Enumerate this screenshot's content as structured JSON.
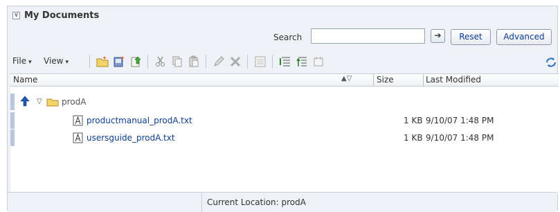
{
  "panel": {
    "collapse_glyph": "∨",
    "title": "My Documents"
  },
  "search": {
    "label": "Search",
    "value": "",
    "placeholder": "",
    "go_glyph": "➔",
    "reset_label": "Reset",
    "advanced_label": "Advanced"
  },
  "toolbar": {
    "file_label": "File",
    "view_label": "View",
    "caret": "▾",
    "icons": [
      "new-folder-icon",
      "new-document-icon",
      "upload-icon",
      "cut-icon",
      "copy-icon",
      "paste-icon",
      "edit-icon",
      "delete-icon",
      "batch-icon",
      "expand-all-icon",
      "collapse-all-icon",
      "properties-icon",
      "refresh-icon"
    ]
  },
  "table": {
    "columns": {
      "name": "Name",
      "sort": "▲▽",
      "size": "Size",
      "modified": "Last Modified"
    },
    "folder": {
      "up_glyph": "🡅",
      "toggle": "▽",
      "name": "prodA"
    },
    "files": [
      {
        "name": "productmanual_prodA.txt",
        "size": "1 KB",
        "modified": "9/10/07 1:48 PM"
      },
      {
        "name": "usersguide_prodA.txt",
        "size": "1 KB",
        "modified": "9/10/07 1:48 PM"
      }
    ]
  },
  "footer": {
    "location": "Current Location: prodA"
  },
  "colors": {
    "accent": "#0b3d91",
    "panel_bg": "#eef1f5",
    "border": "#c9d0d8",
    "row_marker": "#b7c7dd"
  }
}
